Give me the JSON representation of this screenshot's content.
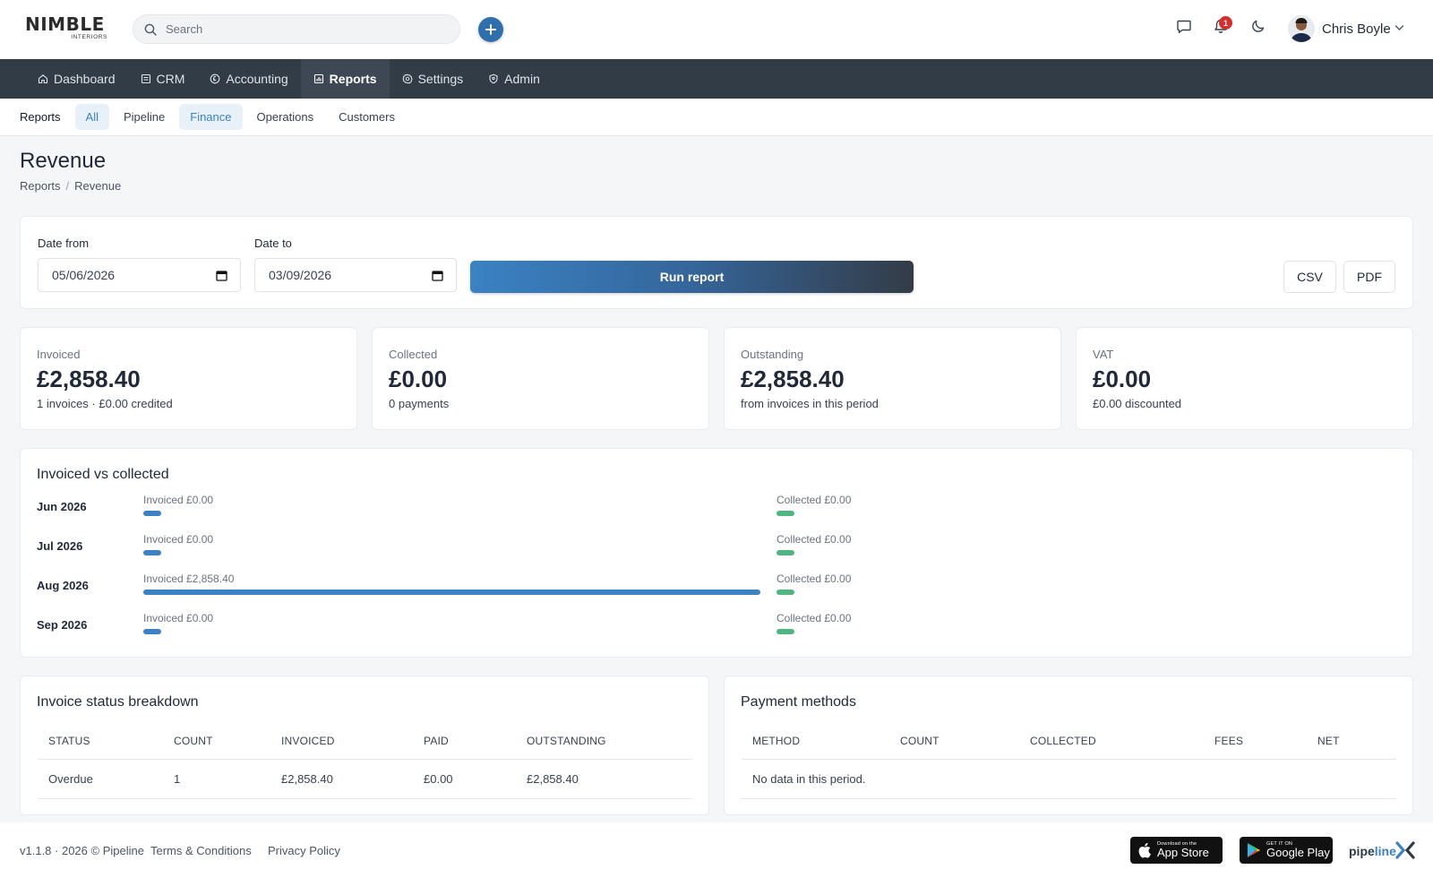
{
  "brand": {
    "logo_main": "NIMBLE",
    "logo_sub": "INTERIORS"
  },
  "search": {
    "placeholder": "Search"
  },
  "user": {
    "name": "Chris Boyle",
    "notification_count": "1"
  },
  "nav": [
    {
      "label": "Dashboard",
      "icon": "home-icon"
    },
    {
      "label": "CRM",
      "icon": "crm-icon"
    },
    {
      "label": "Accounting",
      "icon": "accounting-icon"
    },
    {
      "label": "Reports",
      "icon": "reports-icon",
      "active": true
    },
    {
      "label": "Settings",
      "icon": "gear-icon"
    },
    {
      "label": "Admin",
      "icon": "shield-icon"
    }
  ],
  "subnav": {
    "label": "Reports",
    "items": [
      "All",
      "Pipeline",
      "Finance",
      "Operations",
      "Customers"
    ]
  },
  "page": {
    "title": "Revenue",
    "breadcrumb": [
      "Reports",
      "Revenue"
    ]
  },
  "filters": {
    "date_from_label": "Date from",
    "date_from_value": "05/06/2026",
    "date_to_label": "Date to",
    "date_to_value": "03/09/2026",
    "run_label": "Run report",
    "csv_label": "CSV",
    "pdf_label": "PDF"
  },
  "stats": [
    {
      "label": "Invoiced",
      "value": "£2,858.40",
      "sub": "1 invoices · £0.00 credited"
    },
    {
      "label": "Collected",
      "value": "£0.00",
      "sub": "0 payments"
    },
    {
      "label": "Outstanding",
      "value": "£2,858.40",
      "sub": "from invoices in this period"
    },
    {
      "label": "VAT",
      "value": "£0.00",
      "sub": "£0.00 discounted"
    }
  ],
  "chart_data": {
    "type": "bar",
    "title": "Invoiced vs collected",
    "categories": [
      "Jun 2026",
      "Jul 2026",
      "Aug 2026",
      "Sep 2026"
    ],
    "series": [
      {
        "name": "Invoiced",
        "values": [
          0,
          0,
          2858.4
        ],
        "labels": [
          "Invoiced £0.00",
          "Invoiced £0.00",
          "Invoiced £2,858.40",
          "Invoiced £0.00"
        ]
      },
      {
        "name": "Collected",
        "values": [
          0,
          0,
          0,
          0
        ],
        "labels": [
          "Collected £0.00",
          "Collected £0.00",
          "Collected £0.00",
          "Collected £0.00"
        ]
      }
    ],
    "colors": {
      "Invoiced": "#3a82c4",
      "Collected": "#4fb581"
    }
  },
  "status_table": {
    "title": "Invoice status breakdown",
    "columns": [
      "STATUS",
      "COUNT",
      "INVOICED",
      "PAID",
      "OUTSTANDING"
    ],
    "rows": [
      [
        "Overdue",
        "1",
        "£2,858.40",
        "£0.00",
        "£2,858.40"
      ]
    ]
  },
  "payment_table": {
    "title": "Payment methods",
    "columns": [
      "METHOD",
      "COUNT",
      "COLLECTED",
      "FEES",
      "NET"
    ],
    "empty_text": "No data in this period."
  },
  "footer": {
    "version": "v1.1.8 · 2026 © Pipeline",
    "terms": "Terms & Conditions",
    "privacy": "Privacy Policy",
    "appstore_small": "Download on the",
    "appstore_big": "App Store",
    "googleplay_small": "GET IT ON",
    "googleplay_big": "Google Play",
    "pipeline_logo_a": "pipe",
    "pipeline_logo_b": "line"
  },
  "colors": {
    "accent": "#3a82c4",
    "nav_bg": "#323c47",
    "success": "#4fb581",
    "badge": "#d92d2d"
  }
}
